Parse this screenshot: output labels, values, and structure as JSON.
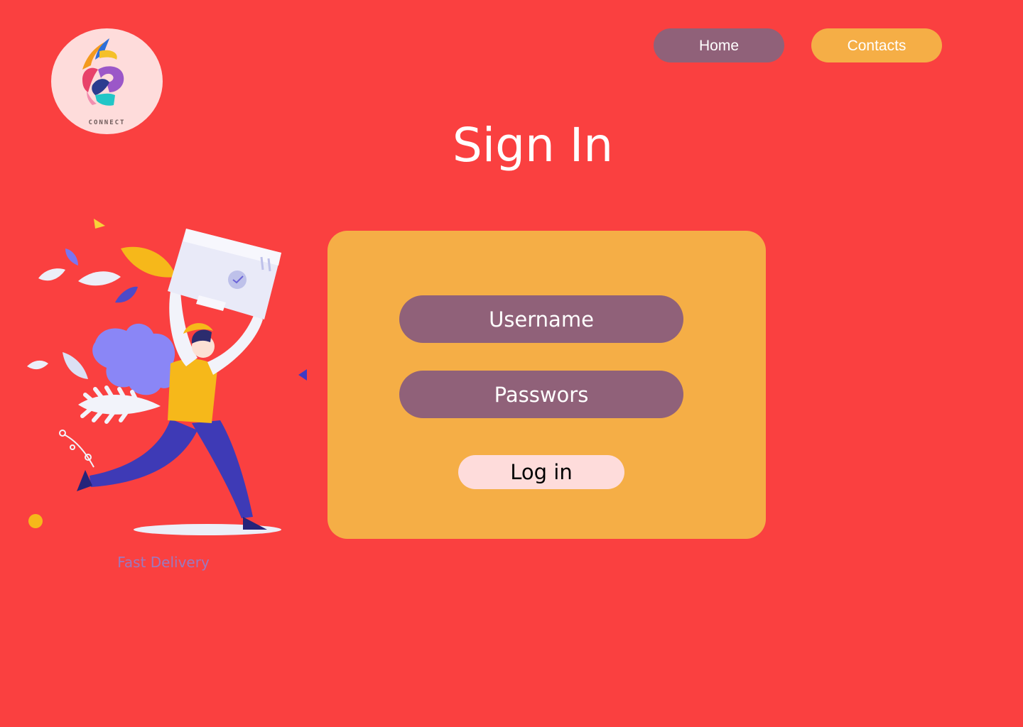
{
  "logo": {
    "wordmark": "CONNECT"
  },
  "nav": {
    "home_label": "Home",
    "contacts_label": "Contacts"
  },
  "page": {
    "title": "Sign In"
  },
  "illustration": {
    "caption": "Fast Delivery"
  },
  "form": {
    "username_placeholder": "Username",
    "password_placeholder": "Passwors",
    "login_label": "Log in"
  },
  "colors": {
    "background": "#FA4040",
    "card": "#F5AE46",
    "field": "#906179",
    "login_button": "#FEDCDB",
    "contacts_button": "#F5AE46",
    "home_button": "#906179"
  }
}
